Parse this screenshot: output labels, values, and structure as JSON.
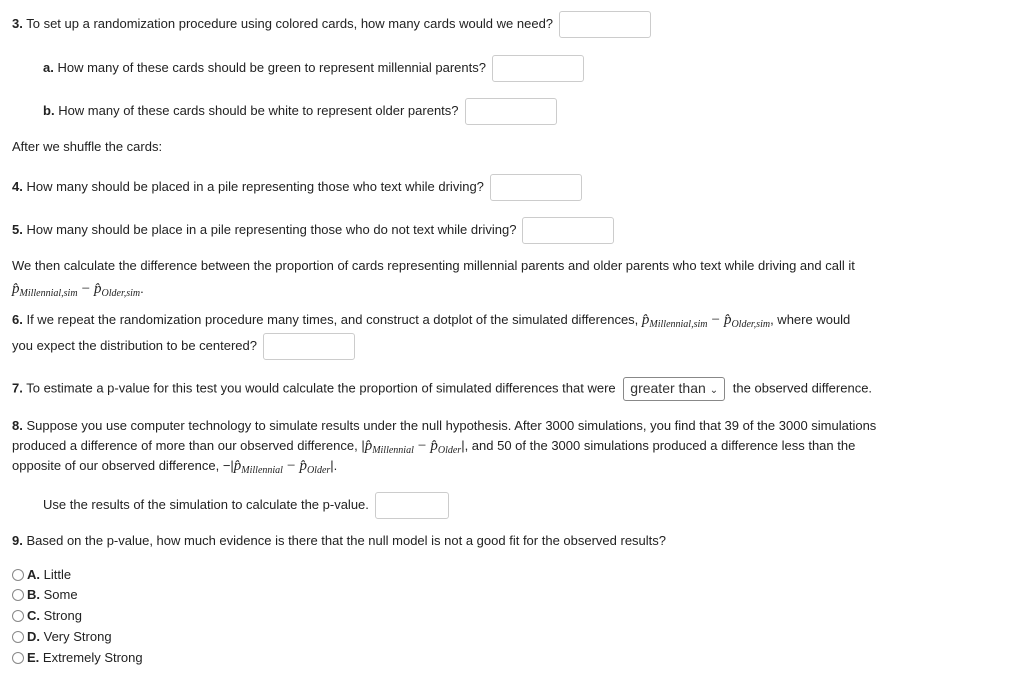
{
  "q3": {
    "num": "3.",
    "text": "To set up a randomization procedure using colored cards, how many cards would we need?"
  },
  "q3a": {
    "num": "a.",
    "text": "How many of these cards should be green to represent millennial parents?"
  },
  "q3b": {
    "num": "b.",
    "text": "How many of these cards should be white to represent older parents?"
  },
  "shuffle": "After we shuffle the cards:",
  "q4": {
    "num": "4.",
    "text": "How many should be placed in a pile representing those who text while driving?"
  },
  "q5": {
    "num": "5.",
    "text": "How many should be place in a pile representing those who do not text while driving?"
  },
  "para": {
    "text": "We then calculate the difference between the proportion of cards representing millennial parents and older parents who text while driving and call it",
    "p": "p̂",
    "sub_mill_sim": "Millennial,sim",
    "minus": "−",
    "sub_old_sim": "Older,sim",
    "end": "."
  },
  "q6": {
    "num": "6.",
    "text": "If we repeat the randomization procedure many times, and construct a dotplot of the simulated differences,",
    "after": ", where would",
    "line2": "you expect the distribution to be centered?"
  },
  "q7": {
    "num": "7.",
    "text": "To estimate a p-value for this test you would calculate the proportion of simulated differences that were",
    "select_value": "greater than",
    "after": "the observed difference."
  },
  "q8": {
    "num": "8.",
    "line1": "Suppose you use computer technology to simulate results under the null hypothesis. After 3000 simulations, you find that 39 of the 3000 simulations",
    "line2a": "produced a difference of more than our observed difference,",
    "line2b": ", and 50 of the 3000 simulations produced a difference less than the",
    "line3a": "opposite of our observed difference,",
    "sub_mill": "Millennial",
    "sub_old": "Older",
    "bar": "|",
    "neg": "−",
    "use": "Use the results of the simulation to calculate the p-value."
  },
  "q9": {
    "num": "9.",
    "text": "Based on the p-value, how much evidence is there that the null model is not a good fit for the observed results?",
    "options": [
      {
        "letter": "A.",
        "label": "Little"
      },
      {
        "letter": "B.",
        "label": "Some"
      },
      {
        "letter": "C.",
        "label": "Strong"
      },
      {
        "letter": "D.",
        "label": "Very Strong"
      },
      {
        "letter": "E.",
        "label": "Extremely Strong"
      }
    ]
  }
}
